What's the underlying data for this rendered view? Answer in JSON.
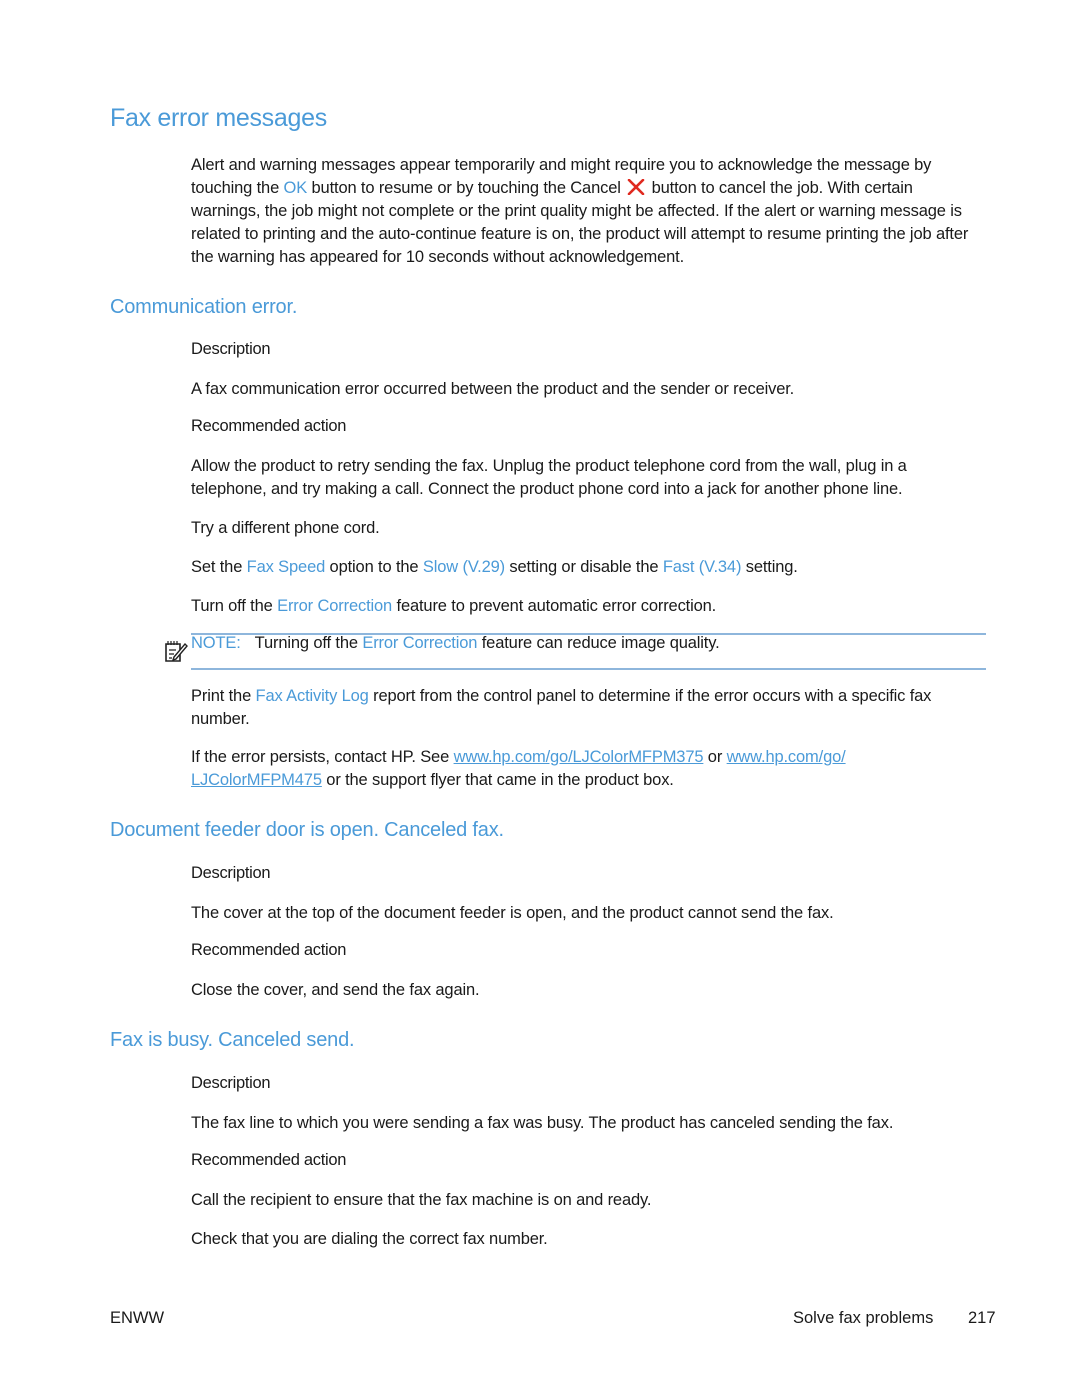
{
  "page": {
    "title": "Fax error messages",
    "intro": {
      "p1": "Alert and warning messages appear temporarily and might require you to acknowledge the message by touching the ",
      "ok": "OK",
      "p2": " button to resume or by touching the Cancel ",
      "cancel_icon": "cancel-x-icon",
      "p3": " button to cancel the job. With certain warnings, the job might not complete or the print quality might be affected. If the alert or warning message is related to printing and the auto-continue feature is on, the product will attempt to resume printing the job after the warning has appeared for 10 seconds without acknowledgement."
    },
    "accent_color": "#4a9ad8",
    "cancel_color": "#e0291f"
  },
  "sections": [
    {
      "heading": "Communication error.",
      "description_label": "Description",
      "description": "A fax communication error occurred between the product and the sender or receiver.",
      "action_label": "Recommended action",
      "actions": {
        "a1": "Allow the product to retry sending the fax. Unplug the product telephone cord from the wall, plug in a telephone, and try making a call. Connect the product phone cord into a jack for another phone line.",
        "a2": "Try a different phone cord.",
        "a3": {
          "t1": "Set the ",
          "l1": "Fax Speed",
          "t2": " option to the ",
          "l2": "Slow (V.29)",
          "t3": " setting or disable the ",
          "l3": "Fast (V.34)",
          "t4": " setting."
        },
        "a4": {
          "t1": "Turn off the ",
          "l1": "Error Correction",
          "t2": " feature to prevent automatic error correction."
        },
        "note": {
          "icon": "note-pencil-icon",
          "label": "NOTE:",
          "t1": "Turning off the ",
          "l1": "Error Correction",
          "t2": " feature can reduce image quality."
        },
        "a5": {
          "t1": "Print the ",
          "l1": "Fax Activity Log",
          "t2": " report from the control panel to determine if the error occurs with a specific fax number."
        },
        "a6": {
          "t1": "If the error persists, contact HP. See ",
          "link1": "www.hp.com/go/LJColorMFPM375",
          "t2": " or ",
          "link2a": "www.hp.com/go/",
          "link2b": "LJColorMFPM475",
          "t3": " or the support flyer that came in the product box."
        }
      }
    },
    {
      "heading": "Document feeder door is open. Canceled fax.",
      "description_label": "Description",
      "description": "The cover at the top of the document feeder is open, and the product cannot send the fax.",
      "action_label": "Recommended action",
      "actions": {
        "a1": "Close the cover, and send the fax again."
      }
    },
    {
      "heading": "Fax is busy. Canceled send.",
      "description_label": "Description",
      "description": "The fax line to which you were sending a fax was busy. The product has canceled sending the fax.",
      "action_label": "Recommended action",
      "actions": {
        "a1": "Call the recipient to ensure that the fax machine is on and ready.",
        "a2": "Check that you are dialing the correct fax number."
      }
    }
  ],
  "footer": {
    "left": "ENWW",
    "section": "Solve fax problems",
    "page_number": "217"
  }
}
